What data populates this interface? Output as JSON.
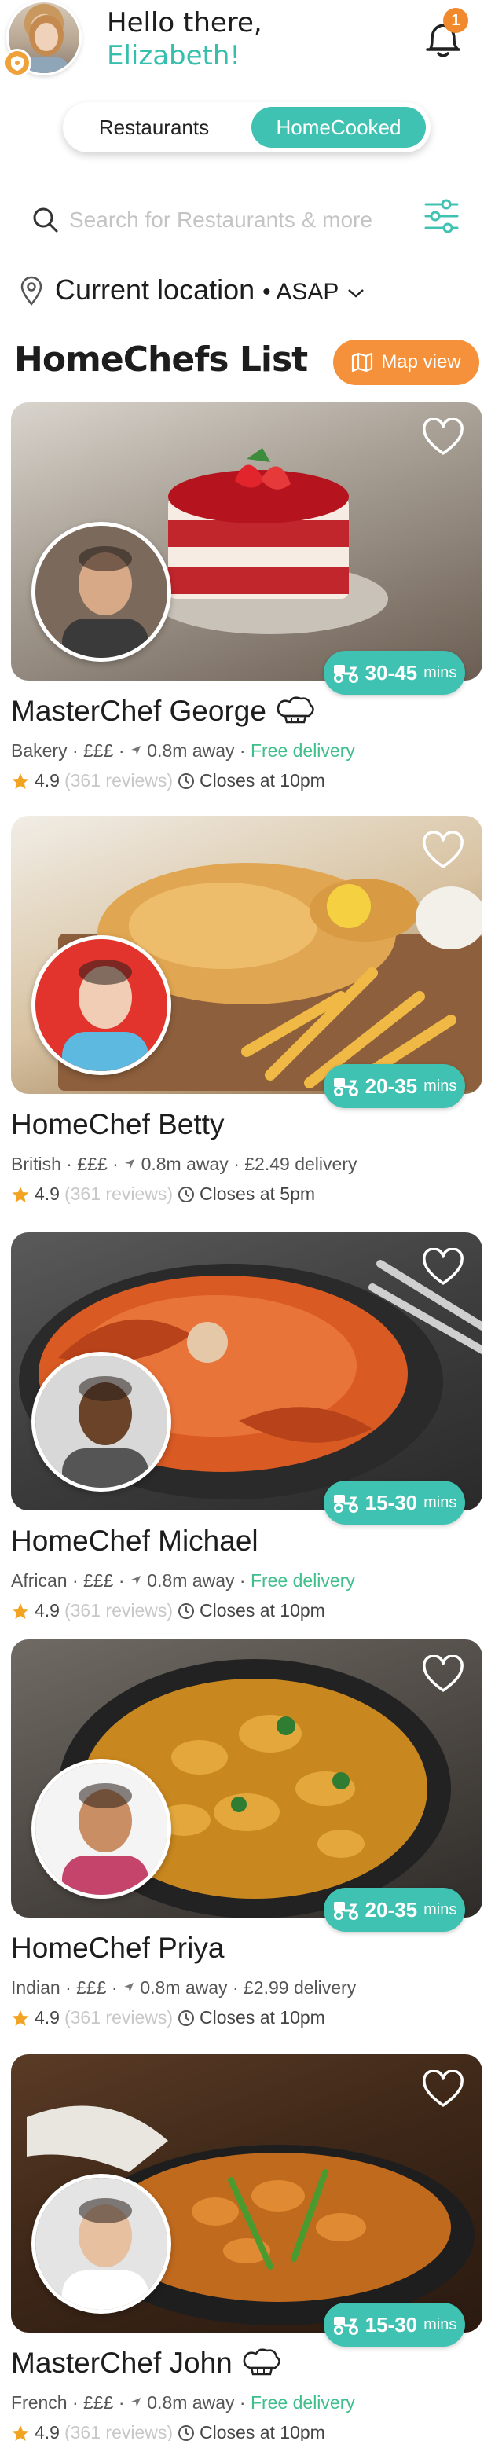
{
  "header": {
    "greeting": "Hello there,",
    "user_name": "Elizabeth!",
    "notification_count": "1"
  },
  "toggle": {
    "left_label": "Restaurants",
    "right_label": "HomeCooked",
    "selected": "HomeCooked"
  },
  "search": {
    "placeholder": "Search for Restaurants & more"
  },
  "location": {
    "label": "Current location",
    "timing": "ASAP"
  },
  "list": {
    "title": "HomeChefs List",
    "map_view_label": "Map view"
  },
  "chefs": [
    {
      "name": "MasterChef George",
      "cuisine": "Bakery",
      "price": "£££",
      "distance": "0.8m away",
      "delivery": "Free delivery",
      "delivery_free": true,
      "rating": "4.9",
      "reviews": "(361 reviews)",
      "closes": "Closes at 10pm",
      "time": "30-45",
      "time_unit": "mins",
      "master": true
    },
    {
      "name": "HomeChef Betty",
      "cuisine": "British",
      "price": "£££",
      "distance": "0.8m away",
      "delivery": "£2.49 delivery",
      "delivery_free": false,
      "rating": "4.9",
      "reviews": "(361 reviews)",
      "closes": "Closes at 5pm",
      "time": "20-35",
      "time_unit": "mins",
      "master": false
    },
    {
      "name": "HomeChef Michael",
      "cuisine": "African",
      "price": "£££",
      "distance": "0.8m away",
      "delivery": "Free delivery",
      "delivery_free": true,
      "rating": "4.9",
      "reviews": "(361 reviews)",
      "closes": "Closes at 10pm",
      "time": "15-30",
      "time_unit": "mins",
      "master": false
    },
    {
      "name": "HomeChef Priya",
      "cuisine": "Indian",
      "price": "£££",
      "distance": "0.8m away",
      "delivery": "£2.99 delivery",
      "delivery_free": false,
      "rating": "4.9",
      "reviews": "(361 reviews)",
      "closes": "Closes at 10pm",
      "time": "20-35",
      "time_unit": "mins",
      "master": false
    },
    {
      "name": "MasterChef John",
      "cuisine": "French",
      "price": "£££",
      "distance": "0.8m away",
      "delivery": "Free delivery",
      "delivery_free": true,
      "rating": "4.9",
      "reviews": "(361 reviews)",
      "closes": "Closes at 10pm",
      "time": "15-30",
      "time_unit": "mins",
      "master": true
    }
  ],
  "colors": {
    "accent_teal": "#3fc2b1",
    "accent_orange": "#f5913a",
    "free_delivery": "#3fbf8c",
    "star": "#f2a322"
  }
}
